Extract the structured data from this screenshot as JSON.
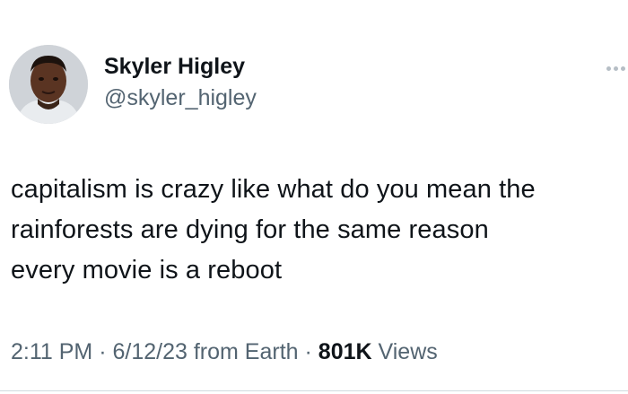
{
  "author": {
    "display_name": "Skyler Higley",
    "handle": "@skyler_higley"
  },
  "tweet": {
    "lines": [
      "capitalism is crazy like what do you mean the",
      "rainforests are dying for the same reason",
      "every movie is a reboot"
    ]
  },
  "meta": {
    "time": "2:11 PM",
    "sep1": "·",
    "date": "6/12/23",
    "source": "from Earth",
    "sep2": "·",
    "views_count": "801K",
    "views_label": "Views"
  },
  "icons": {
    "more": "more-options-icon"
  },
  "colors": {
    "text": "#0f1419",
    "secondary": "#536471",
    "divider": "#cfd9de"
  }
}
